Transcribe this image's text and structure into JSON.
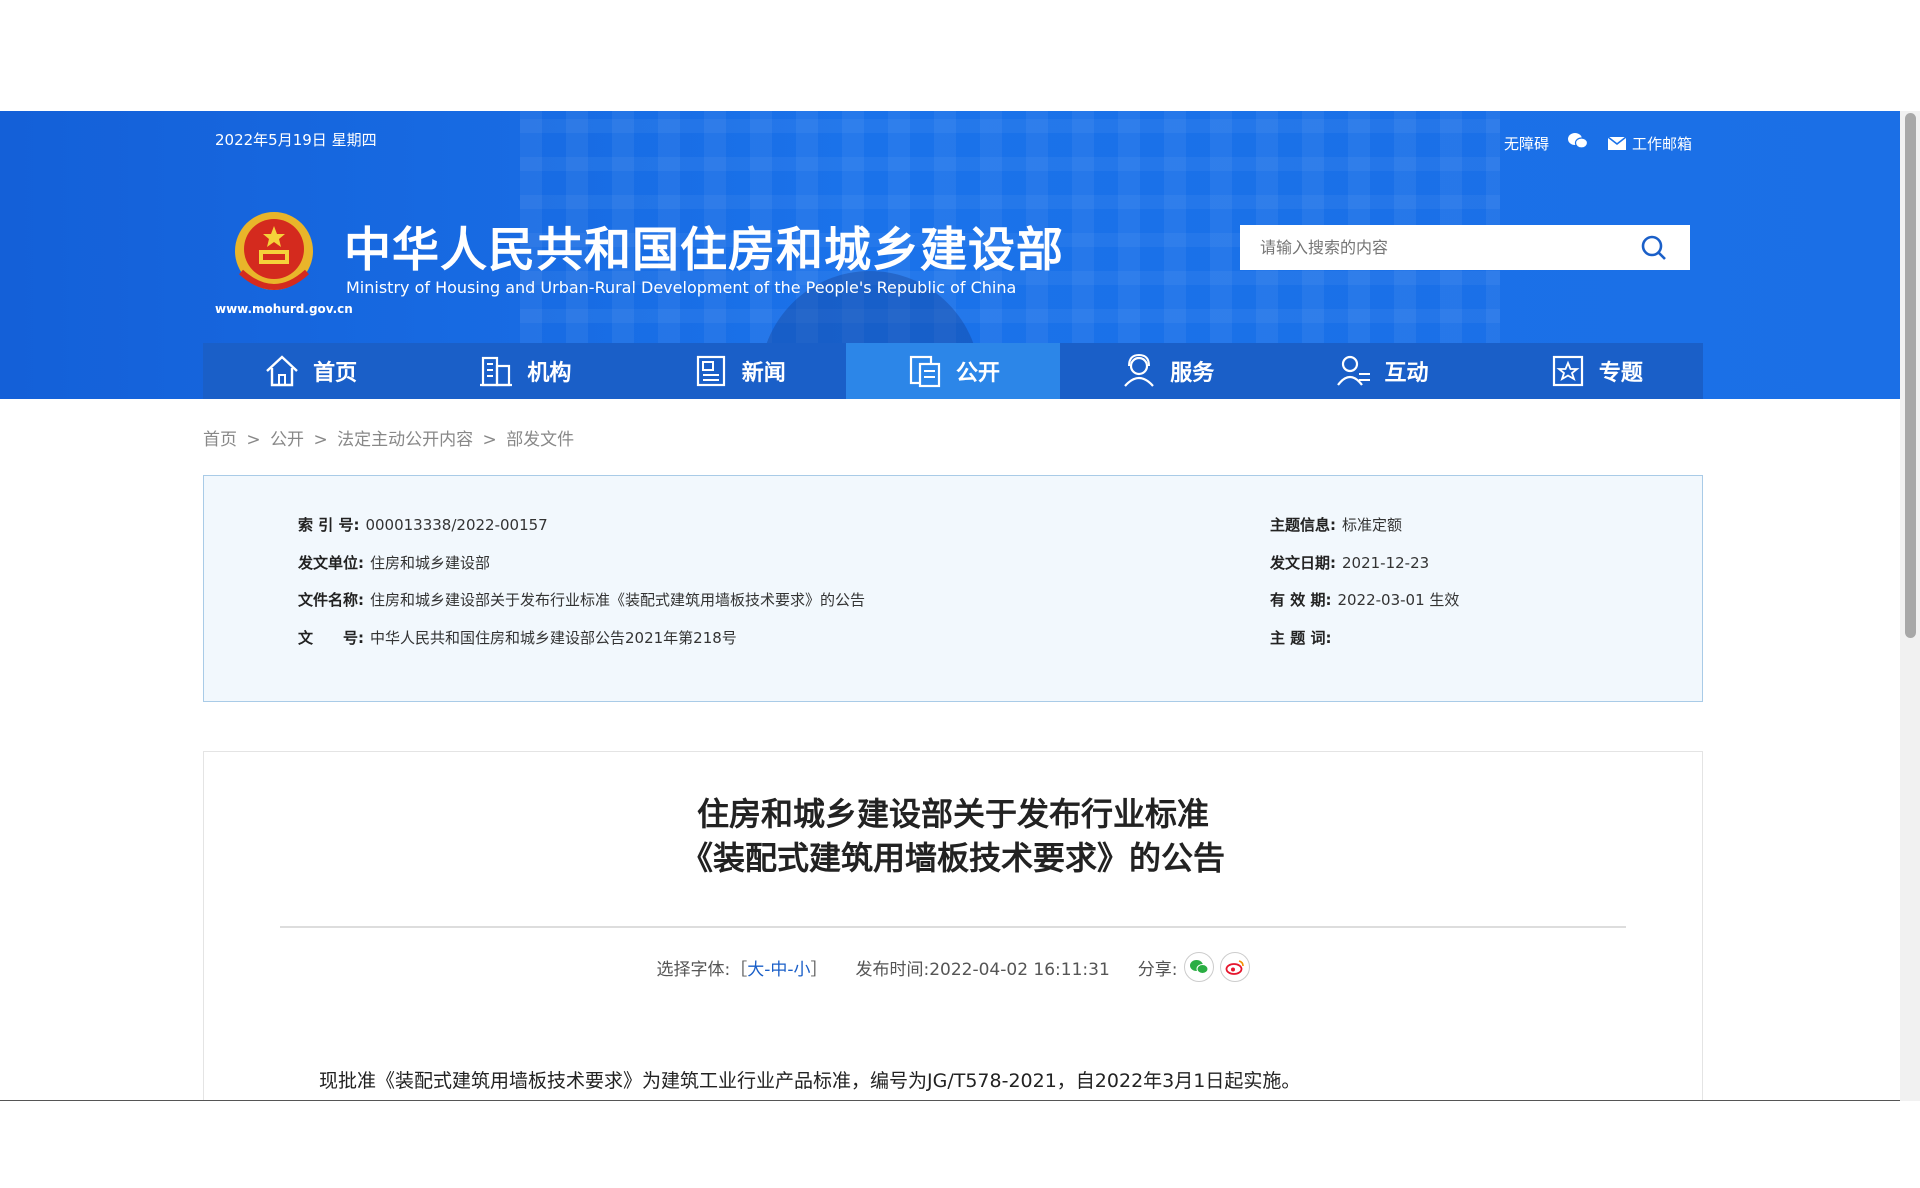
{
  "header": {
    "date": "2022年5月19日 星期四",
    "accessibility": "无障碍",
    "wechat_icon": "wechat-icon",
    "mail_label": "工作邮箱",
    "site_url": "www.mohurd.gov.cn",
    "site_title": "中华人民共和国住房和城乡建设部",
    "site_subtitle": "Ministry of Housing and Urban-Rural Development of the People's Republic of China",
    "search_placeholder": "请输入搜索的内容",
    "brand_color": "#1a72ea"
  },
  "nav": {
    "items": [
      {
        "label": "首页",
        "icon": "home-icon"
      },
      {
        "label": "机构",
        "icon": "building-icon"
      },
      {
        "label": "新闻",
        "icon": "news-icon"
      },
      {
        "label": "公开",
        "icon": "open-icon",
        "active": true
      },
      {
        "label": "服务",
        "icon": "service-icon"
      },
      {
        "label": "互动",
        "icon": "interact-icon"
      },
      {
        "label": "专题",
        "icon": "topic-icon"
      }
    ]
  },
  "breadcrumb": [
    "首页",
    ">",
    "公开",
    ">",
    "法定主动公开内容",
    ">",
    "部发文件"
  ],
  "meta": {
    "index_label": "索 引 号:",
    "index_value": "000013338/2022-00157",
    "issuer_label": "发文单位:",
    "issuer_value": "住房和城乡建设部",
    "name_label": "文件名称:",
    "name_value": "住房和城乡建设部关于发布行业标准《装配式建筑用墙板技术要求》的公告",
    "docno_label": "文　　号:",
    "docno_value": "中华人民共和国住房和城乡建设部公告2021年第218号",
    "topic_label": "主题信息:",
    "topic_value": "标准定额",
    "date_label": "发文日期:",
    "date_value": "2021-12-23",
    "valid_label": "有 效 期:",
    "valid_value": "2022-03-01 生效",
    "keyword_label": "主 题 词:",
    "keyword_value": ""
  },
  "article": {
    "title_line1": "住房和城乡建设部关于发布行业标准",
    "title_line2": "《装配式建筑用墙板技术要求》的公告",
    "font_label": "选择字体:［",
    "font_large": "大",
    "font_mid": "中",
    "font_small": "小",
    "font_close": "］",
    "sep": "-",
    "publish_label": "发布时间:",
    "publish_time": "2022-04-02 16:11:31",
    "share_label": "分享:",
    "body": "现批准《装配式建筑用墙板技术要求》为建筑工业行业产品标准，编号为JG/T578-2021，自2022年3月1日起实施。"
  }
}
